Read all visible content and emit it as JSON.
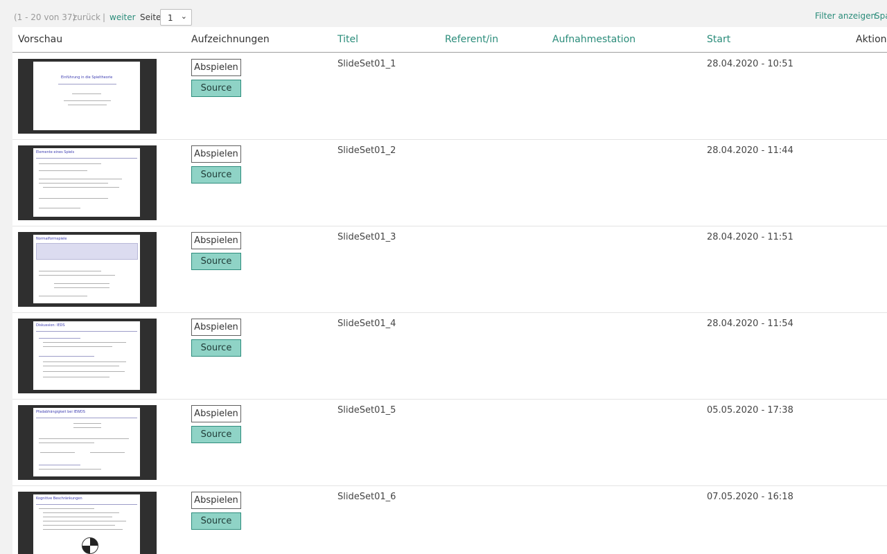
{
  "pager": {
    "range": "(1 - 20 von 37)",
    "prev": "zurück",
    "separator": "|",
    "next": "weiter",
    "page_label": "Seite",
    "page_value": "1"
  },
  "toolbar": {
    "filter": "Filter anzeigen",
    "columns": "Spalten"
  },
  "table": {
    "headers": {
      "preview": "Vorschau",
      "recordings": "Aufzeichnungen",
      "title": "Titel",
      "speaker": "Referent/in",
      "station": "Aufnahmestation",
      "start": "Start",
      "actions": "Aktionen"
    },
    "rows": [
      {
        "title": "SlideSet01_1",
        "speaker": "",
        "station": "",
        "start": "28.04.2020 - 10:51",
        "play": "Abspielen",
        "source": "Source",
        "slide_heading": "Einführung in die Spieltheorie"
      },
      {
        "title": "SlideSet01_2",
        "speaker": "",
        "station": "",
        "start": "28.04.2020 - 11:44",
        "play": "Abspielen",
        "source": "Source",
        "slide_heading": "Elemente eines Spiels"
      },
      {
        "title": "SlideSet01_3",
        "speaker": "",
        "station": "",
        "start": "28.04.2020 - 11:51",
        "play": "Abspielen",
        "source": "Source",
        "slide_heading": "Normalformspiele"
      },
      {
        "title": "SlideSet01_4",
        "speaker": "",
        "station": "",
        "start": "28.04.2020 - 11:54",
        "play": "Abspielen",
        "source": "Source",
        "slide_heading": "Diskussion: IEDS"
      },
      {
        "title": "SlideSet01_5",
        "speaker": "",
        "station": "",
        "start": "05.05.2020 - 17:38",
        "play": "Abspielen",
        "source": "Source",
        "slide_heading": "Pfadabhängigkeit bei IEWDS"
      },
      {
        "title": "SlideSet01_6",
        "speaker": "",
        "station": "",
        "start": "07.05.2020 - 16:18",
        "play": "Abspielen",
        "source": "Source",
        "slide_heading": "Kognitive Beschränkungen"
      }
    ]
  },
  "colors": {
    "accent": "#2a8c7a",
    "source_button_bg": "#8fd3c6",
    "page_bg": "#f2f2f2",
    "thumb_frame": "#2f2f2f"
  }
}
